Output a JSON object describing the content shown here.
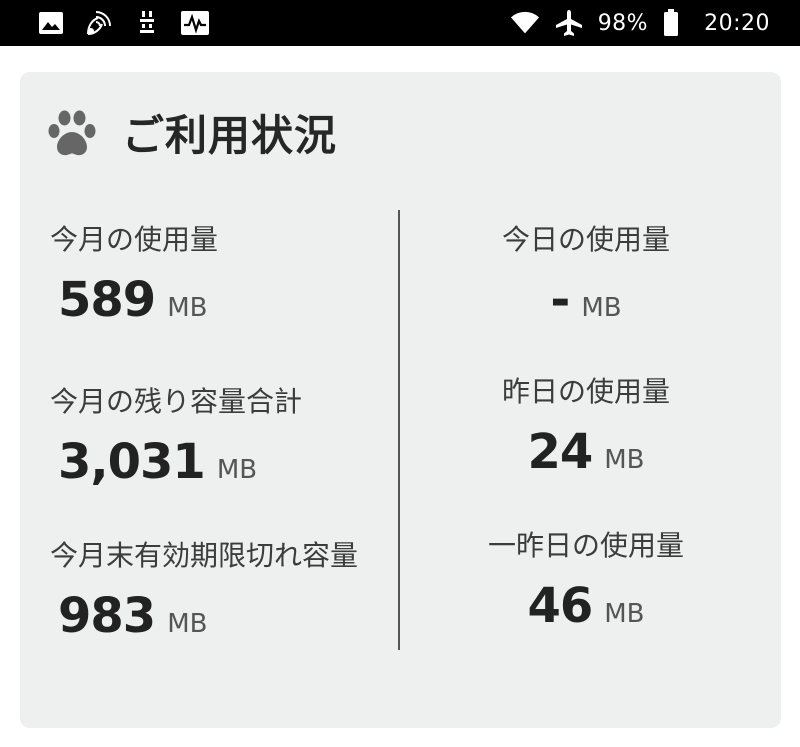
{
  "status_bar": {
    "left_icons": [
      "image-icon",
      "satellite-icon",
      "usb-debug-icon",
      "activity-icon"
    ],
    "right_icons": [
      "wifi-icon",
      "airplane-icon",
      "battery-icon"
    ],
    "battery": "98%",
    "time": "20:20"
  },
  "card": {
    "title": "ご利用状況",
    "icon": "paw-icon",
    "left": [
      {
        "label": "今月の使用量",
        "value": "589",
        "unit": "MB"
      },
      {
        "label": "今月の残り容量合計",
        "value": "3,031",
        "unit": "MB"
      },
      {
        "label": "今月末有効期限切れ容量",
        "value": "983",
        "unit": "MB"
      }
    ],
    "right": [
      {
        "label": "今日の使用量",
        "value": "-",
        "unit": "MB"
      },
      {
        "label": "昨日の使用量",
        "value": "24",
        "unit": "MB"
      },
      {
        "label": "一昨日の使用量",
        "value": "46",
        "unit": "MB"
      }
    ]
  }
}
